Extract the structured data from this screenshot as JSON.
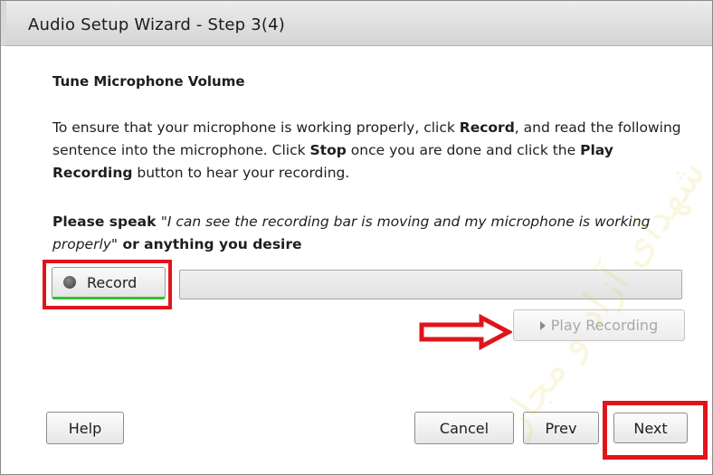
{
  "window": {
    "title": "Audio Setup Wizard - Step 3(4)"
  },
  "content": {
    "heading": "Tune Microphone Volume",
    "instructions": {
      "part1": "To ensure that your microphone is working properly, click ",
      "record_word": "Record",
      "part2": ", and read the following sentence into the microphone. Click ",
      "stop_word": "Stop",
      "part3": " once you are done and click the ",
      "play_word": "Play Recording",
      "part4": " button to hear your recording."
    },
    "speak": {
      "prefix": "Please speak ",
      "quote": "\"I can see the recording bar is moving and my microphone is working properly\"",
      "suffix": " or anything you desire"
    }
  },
  "controls": {
    "record_label": "Record",
    "play_recording_label": "Play Recording",
    "level_fraction": 0
  },
  "buttons": {
    "help": "Help",
    "cancel": "Cancel",
    "prev": "Prev",
    "next": "Next"
  },
  "annotations": {
    "highlight_color": "#e0141b"
  },
  "icons": {
    "record": "record-dot-icon",
    "play": "play-triangle-icon",
    "pointer_arrow": "right-arrow-icon"
  },
  "watermark_text": "شهدای آزاد و مجاز"
}
